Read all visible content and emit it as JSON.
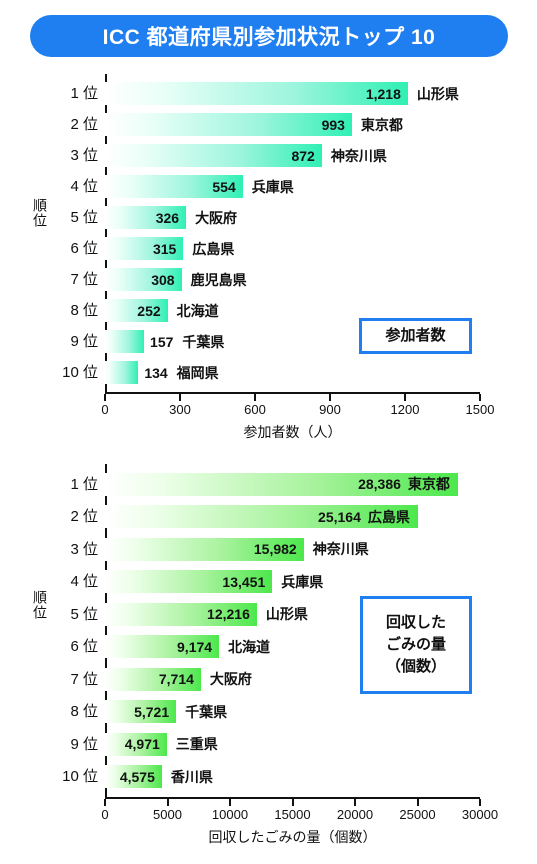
{
  "title": "ICC 都道府県別参加状況トップ 10",
  "theme": {
    "banner_bg": "#1f7ff0",
    "banner_text": "#ffffff",
    "legend_border": "#1f7ff0",
    "bar_chart1_end": "#2ff0b4",
    "bar_chart2_end": "#4ce84c",
    "axis": "#111111"
  },
  "charts": [
    {
      "id": "participants",
      "legend_lines": [
        "参加者数"
      ],
      "ylabel": "順位",
      "xlabel": "参加者数（人）",
      "chart_data": {
        "type": "bar",
        "orientation": "horizontal",
        "title": "ICC 都道府県別参加状況トップ 10",
        "xlabel": "参加者数（人）",
        "ylabel": "順位",
        "xlim": [
          0,
          1500
        ],
        "ticks": [
          0,
          300,
          600,
          900,
          1200,
          1500
        ],
        "tick_labels": [
          "0",
          "300",
          "600",
          "900",
          "1200",
          "1500"
        ],
        "grid": false,
        "legend": "参加者数",
        "categories": [
          "1 位",
          "2 位",
          "3 位",
          "4 位",
          "5 位",
          "6 位",
          "7 位",
          "8 位",
          "9 位",
          "10 位"
        ],
        "values": [
          1218,
          993,
          872,
          554,
          326,
          315,
          308,
          252,
          157,
          134
        ],
        "value_labels": [
          "1,218",
          "993",
          "872",
          "554",
          "326",
          "315",
          "308",
          "252",
          "157",
          "134"
        ],
        "series_names": [
          "山形県",
          "東京都",
          "神奈川県",
          "兵庫県",
          "大阪府",
          "広島県",
          "鹿児島県",
          "北海道",
          "千葉県",
          "福岡県"
        ]
      },
      "rows": [
        {
          "rank": "1 位",
          "value": 1218,
          "value_label": "1,218",
          "name": "山形県",
          "value_inside": true
        },
        {
          "rank": "2 位",
          "value": 993,
          "value_label": "993",
          "name": "東京都",
          "value_inside": true
        },
        {
          "rank": "3 位",
          "value": 872,
          "value_label": "872",
          "name": "神奈川県",
          "value_inside": true
        },
        {
          "rank": "4 位",
          "value": 554,
          "value_label": "554",
          "name": "兵庫県",
          "value_inside": true
        },
        {
          "rank": "5 位",
          "value": 326,
          "value_label": "326",
          "name": "大阪府",
          "value_inside": true
        },
        {
          "rank": "6 位",
          "value": 315,
          "value_label": "315",
          "name": "広島県",
          "value_inside": true
        },
        {
          "rank": "7 位",
          "value": 308,
          "value_label": "308",
          "name": "鹿児島県",
          "value_inside": true
        },
        {
          "rank": "8 位",
          "value": 252,
          "value_label": "252",
          "name": "北海道",
          "value_inside": true
        },
        {
          "rank": "9 位",
          "value": 157,
          "value_label": "157",
          "name": "千葉県",
          "value_inside": false
        },
        {
          "rank": "10 位",
          "value": 134,
          "value_label": "134",
          "name": "福岡県",
          "value_inside": false
        }
      ]
    },
    {
      "id": "trash",
      "legend_lines": [
        "回収した",
        "ごみの量",
        "（個数）"
      ],
      "ylabel": "順位",
      "xlabel": "回収したごみの量（個数）",
      "chart_data": {
        "type": "bar",
        "orientation": "horizontal",
        "title": "ICC 都道府県別参加状況トップ 10",
        "xlabel": "回収したごみの量（個数）",
        "ylabel": "順位",
        "xlim": [
          0,
          30000
        ],
        "ticks": [
          0,
          5000,
          10000,
          15000,
          20000,
          25000,
          30000
        ],
        "tick_labels": [
          "0",
          "5000",
          "10000",
          "15000",
          "20000",
          "25000",
          "30000"
        ],
        "grid": false,
        "legend": "回収したごみの量（個数）",
        "categories": [
          "1 位",
          "2 位",
          "3 位",
          "4 位",
          "5 位",
          "6 位",
          "7 位",
          "8 位",
          "9 位",
          "10 位"
        ],
        "values": [
          28386,
          25164,
          15982,
          13451,
          12216,
          9174,
          7714,
          5721,
          4971,
          4575
        ],
        "value_labels": [
          "28,386",
          "25,164",
          "15,982",
          "13,451",
          "12,216",
          "9,174",
          "7,714",
          "5,721",
          "4,971",
          "4,575"
        ],
        "series_names": [
          "東京都",
          "広島県",
          "神奈川県",
          "兵庫県",
          "山形県",
          "北海道",
          "大阪府",
          "千葉県",
          "三重県",
          "香川県"
        ]
      },
      "rows": [
        {
          "rank": "1 位",
          "value": 28386,
          "value_label": "28,386",
          "name": "東京都",
          "value_inside": true,
          "name_inside": true
        },
        {
          "rank": "2 位",
          "value": 25164,
          "value_label": "25,164",
          "name": "広島県",
          "value_inside": true,
          "name_inside": true
        },
        {
          "rank": "3 位",
          "value": 15982,
          "value_label": "15,982",
          "name": "神奈川県",
          "value_inside": true,
          "name_inside": false
        },
        {
          "rank": "4 位",
          "value": 13451,
          "value_label": "13,451",
          "name": "兵庫県",
          "value_inside": true,
          "name_inside": false
        },
        {
          "rank": "5 位",
          "value": 12216,
          "value_label": "12,216",
          "name": "山形県",
          "value_inside": true,
          "name_inside": false
        },
        {
          "rank": "6 位",
          "value": 9174,
          "value_label": "9,174",
          "name": "北海道",
          "value_inside": true,
          "name_inside": false
        },
        {
          "rank": "7 位",
          "value": 7714,
          "value_label": "7,714",
          "name": "大阪府",
          "value_inside": true,
          "name_inside": false
        },
        {
          "rank": "8 位",
          "value": 5721,
          "value_label": "5,721",
          "name": "千葉県",
          "value_inside": true,
          "name_inside": false
        },
        {
          "rank": "9 位",
          "value": 4971,
          "value_label": "4,971",
          "name": "三重県",
          "value_inside": true,
          "name_inside": false
        },
        {
          "rank": "10 位",
          "value": 4575,
          "value_label": "4,575",
          "name": "香川県",
          "value_inside": true,
          "name_inside": false
        }
      ]
    }
  ]
}
